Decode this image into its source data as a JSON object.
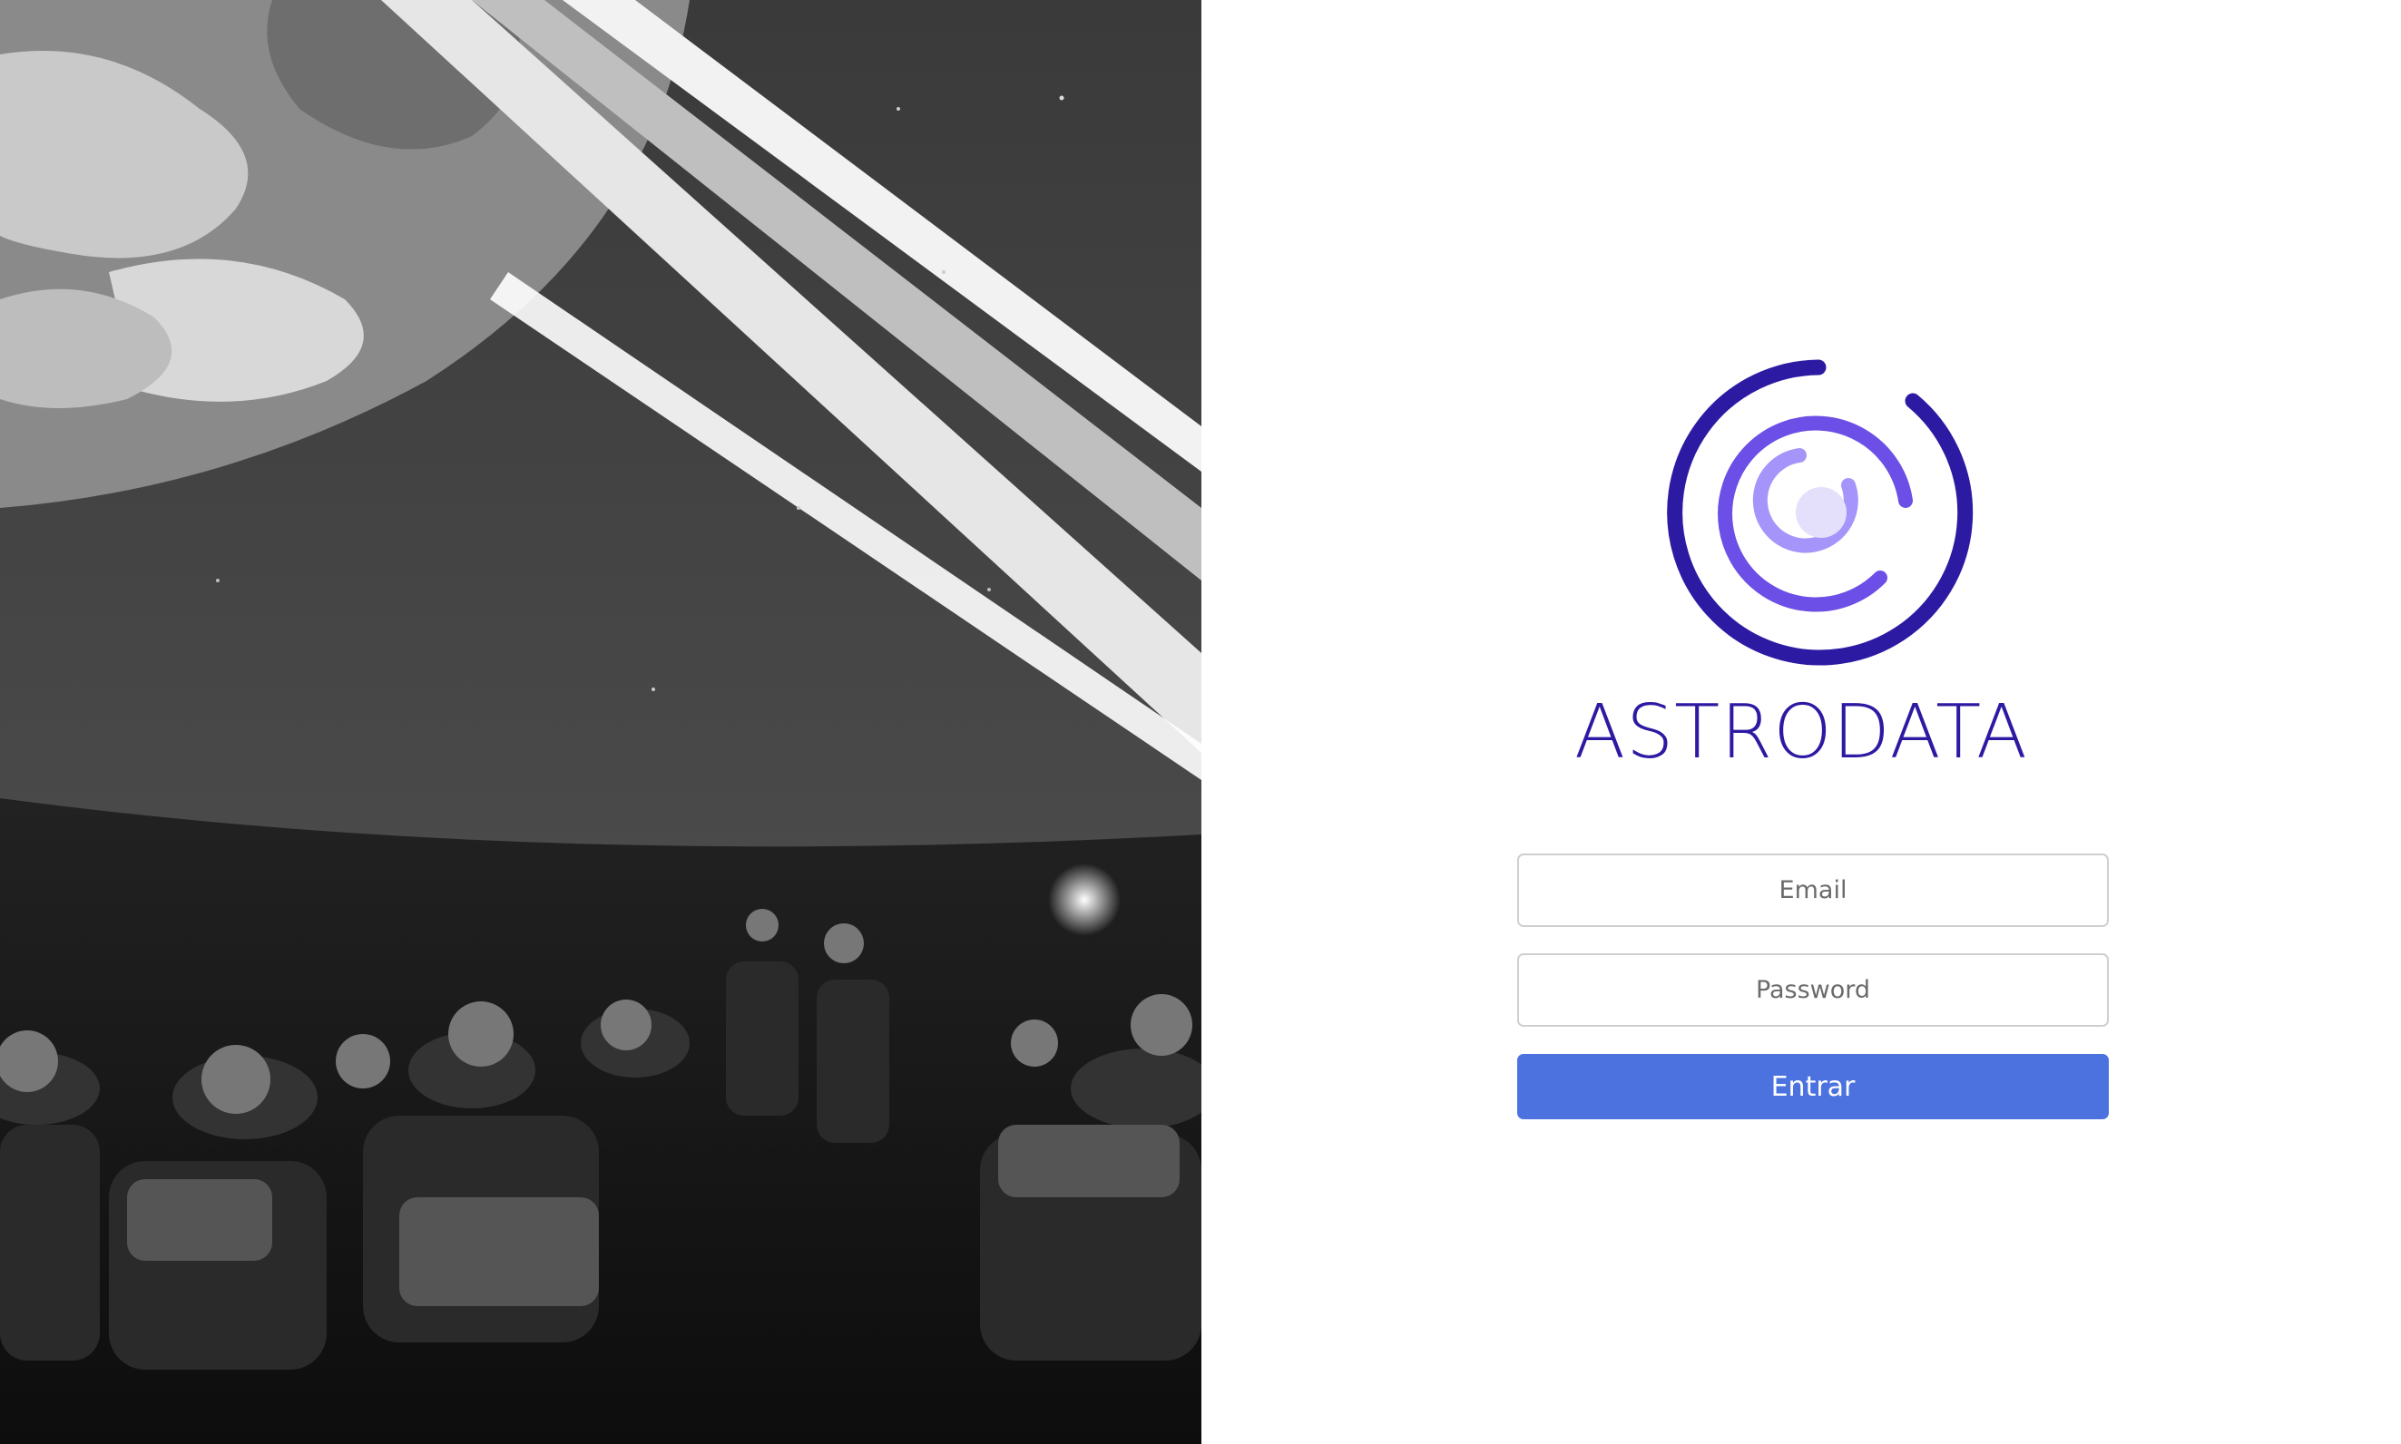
{
  "brand": {
    "name": "ASTRODATA",
    "logo_icon": "astrodata-orbit-logo-icon",
    "colors": {
      "primary": "#2d1aa3",
      "secondary": "#6b4fe6",
      "tertiary": "#a594f9",
      "core": "#e4e0fb"
    }
  },
  "hero_image": {
    "subject": "planetarium-audience-photo",
    "style": "grayscale"
  },
  "login": {
    "email_placeholder": "Email",
    "password_placeholder": "Password",
    "submit_label": "Entrar",
    "accent_color": "#4c72e0"
  }
}
